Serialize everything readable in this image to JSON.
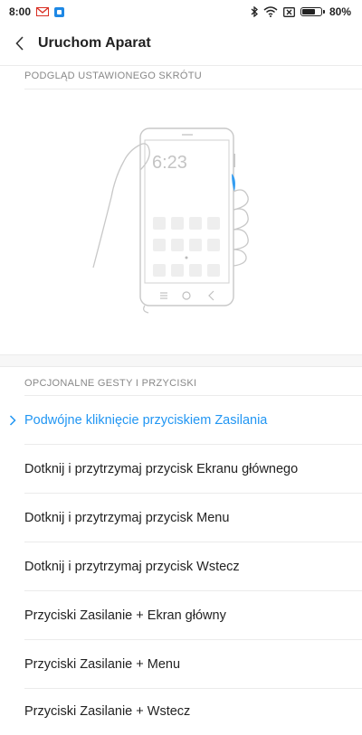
{
  "status_bar": {
    "time": "8:00",
    "battery": "80%",
    "battery_level": 0.8
  },
  "toolbar": {
    "title": "Uruchom Aparat"
  },
  "preview_section": {
    "header": "PODGLĄD USTAWIONEGO SKRÓTU",
    "phone_clock": "6:23"
  },
  "options_section": {
    "header": "OPCJONALNE GESTY I PRZYCISKI",
    "items": [
      {
        "label": "Podwójne kliknięcie przyciskiem Zasilania",
        "selected": true
      },
      {
        "label": "Dotknij i przytrzymaj przycisk Ekranu głównego",
        "selected": false
      },
      {
        "label": "Dotknij i przytrzymaj przycisk Menu",
        "selected": false
      },
      {
        "label": "Dotknij i przytrzymaj przycisk Wstecz",
        "selected": false
      },
      {
        "label": "Przyciski Zasilanie + Ekran główny",
        "selected": false
      },
      {
        "label": "Przyciski Zasilanie + Menu",
        "selected": false
      },
      {
        "label": "Przyciski Zasilanie + Wstecz",
        "selected": false
      }
    ]
  },
  "colors": {
    "accent": "#2196f3",
    "gmail_red": "#d93025",
    "app_icon_blue": "#1e88e5"
  }
}
